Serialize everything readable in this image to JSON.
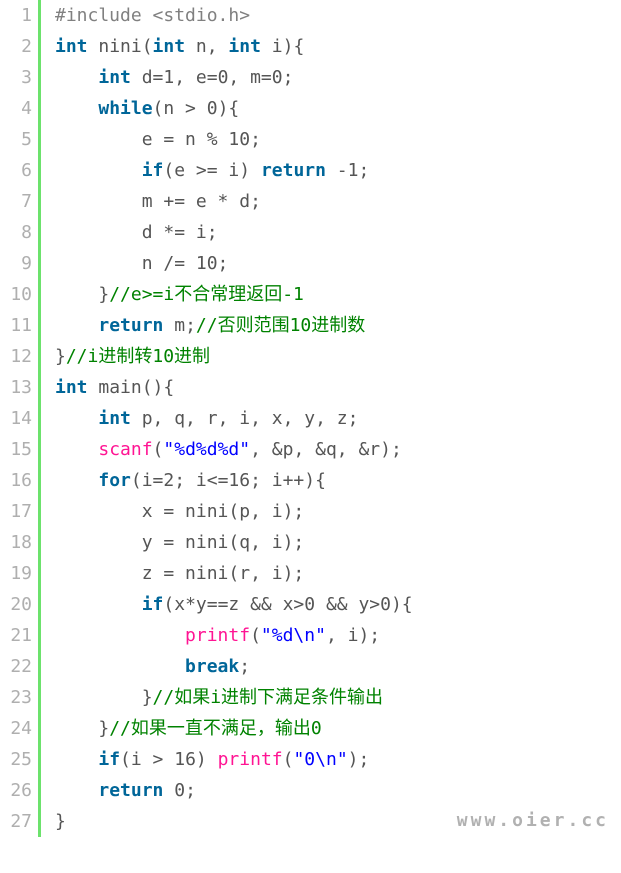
{
  "lineNumbers": [
    "1",
    "2",
    "3",
    "4",
    "5",
    "6",
    "7",
    "8",
    "9",
    "10",
    "11",
    "12",
    "13",
    "14",
    "15",
    "16",
    "17",
    "18",
    "19",
    "20",
    "21",
    "22",
    "23",
    "24",
    "25",
    "26",
    "27"
  ],
  "code": [
    [
      {
        "t": "pp",
        "v": "#include <stdio.h>"
      }
    ],
    [
      {
        "t": "kw",
        "v": "int"
      },
      {
        "t": "",
        "v": " nini("
      },
      {
        "t": "kw",
        "v": "int"
      },
      {
        "t": "",
        "v": " n, "
      },
      {
        "t": "kw",
        "v": "int"
      },
      {
        "t": "",
        "v": " i){"
      }
    ],
    [
      {
        "t": "",
        "v": "    "
      },
      {
        "t": "kw",
        "v": "int"
      },
      {
        "t": "",
        "v": " d=1, e=0, m=0;"
      }
    ],
    [
      {
        "t": "",
        "v": "    "
      },
      {
        "t": "kw",
        "v": "while"
      },
      {
        "t": "",
        "v": "(n > 0){"
      }
    ],
    [
      {
        "t": "",
        "v": "        e = n % 10;"
      }
    ],
    [
      {
        "t": "",
        "v": "        "
      },
      {
        "t": "kw",
        "v": "if"
      },
      {
        "t": "",
        "v": "(e >= i) "
      },
      {
        "t": "kw",
        "v": "return"
      },
      {
        "t": "",
        "v": " -1;"
      }
    ],
    [
      {
        "t": "",
        "v": "        m += e * d;"
      }
    ],
    [
      {
        "t": "",
        "v": "        d *= i;"
      }
    ],
    [
      {
        "t": "",
        "v": "        n /= 10;"
      }
    ],
    [
      {
        "t": "",
        "v": "    }"
      },
      {
        "t": "cm",
        "v": "//e>=i不合常理返回-1"
      }
    ],
    [
      {
        "t": "",
        "v": "    "
      },
      {
        "t": "kw",
        "v": "return"
      },
      {
        "t": "",
        "v": " m;"
      },
      {
        "t": "cm",
        "v": "//否则范围10进制数"
      }
    ],
    [
      {
        "t": "",
        "v": "}"
      },
      {
        "t": "cm",
        "v": "//i进制转10进制"
      }
    ],
    [
      {
        "t": "kw",
        "v": "int"
      },
      {
        "t": "",
        "v": " main(){"
      }
    ],
    [
      {
        "t": "",
        "v": "    "
      },
      {
        "t": "kw",
        "v": "int"
      },
      {
        "t": "",
        "v": " p, q, r, i, x, y, z;"
      }
    ],
    [
      {
        "t": "",
        "v": "    "
      },
      {
        "t": "fn",
        "v": "scanf"
      },
      {
        "t": "",
        "v": "("
      },
      {
        "t": "str",
        "v": "\"%d%d%d\""
      },
      {
        "t": "",
        "v": ", &p, &q, &r);"
      }
    ],
    [
      {
        "t": "",
        "v": "    "
      },
      {
        "t": "kw",
        "v": "for"
      },
      {
        "t": "",
        "v": "(i=2; i<=16; i++){"
      }
    ],
    [
      {
        "t": "",
        "v": "        x = nini(p, i);"
      }
    ],
    [
      {
        "t": "",
        "v": "        y = nini(q, i);"
      }
    ],
    [
      {
        "t": "",
        "v": "        z = nini(r, i);"
      }
    ],
    [
      {
        "t": "",
        "v": "        "
      },
      {
        "t": "kw",
        "v": "if"
      },
      {
        "t": "",
        "v": "(x*y==z && x>0 && y>0){"
      }
    ],
    [
      {
        "t": "",
        "v": "            "
      },
      {
        "t": "fn",
        "v": "printf"
      },
      {
        "t": "",
        "v": "("
      },
      {
        "t": "str",
        "v": "\"%d\\n\""
      },
      {
        "t": "",
        "v": ", i);"
      }
    ],
    [
      {
        "t": "",
        "v": "            "
      },
      {
        "t": "kw",
        "v": "break"
      },
      {
        "t": "",
        "v": ";"
      }
    ],
    [
      {
        "t": "",
        "v": "        }"
      },
      {
        "t": "cm",
        "v": "//如果i进制下满足条件输出"
      }
    ],
    [
      {
        "t": "",
        "v": "    }"
      },
      {
        "t": "cm",
        "v": "//如果一直不满足，输出0"
      }
    ],
    [
      {
        "t": "",
        "v": "    "
      },
      {
        "t": "kw",
        "v": "if"
      },
      {
        "t": "",
        "v": "(i > 16) "
      },
      {
        "t": "fn",
        "v": "printf"
      },
      {
        "t": "",
        "v": "("
      },
      {
        "t": "str",
        "v": "\"0\\n\""
      },
      {
        "t": "",
        "v": ");"
      }
    ],
    [
      {
        "t": "",
        "v": "    "
      },
      {
        "t": "kw",
        "v": "return"
      },
      {
        "t": "",
        "v": " 0;"
      }
    ],
    [
      {
        "t": "",
        "v": "}"
      }
    ]
  ],
  "watermark": "www.oier.cc"
}
